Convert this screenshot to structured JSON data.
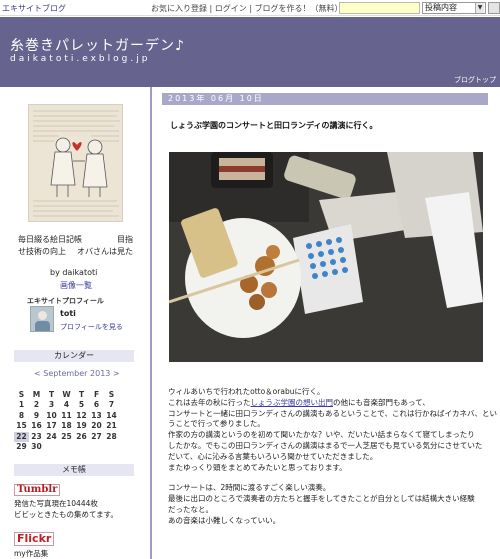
{
  "topbar": {
    "brand": "エキサイトブログ",
    "links": [
      "お気に入り登録",
      "ログイン",
      "ブログを作る！（無料）"
    ],
    "search_value": "",
    "search_scope": "投稿内容"
  },
  "header": {
    "title": "糸巻きパレットガーデン♪",
    "url": "daikatoti.exblog.jp",
    "blog_top": "ブログトップ"
  },
  "sidebar": {
    "diary_line1_left": "毎日綴る絵日記帳",
    "diary_line1_right": "目指",
    "diary_line2_left": "せ技術の向上",
    "diary_line2_right": "オバさんは見た",
    "by": "by daikatoti",
    "gallery_link": "画像一覧",
    "excite_profile": "エキサイトプロフィール",
    "profile_name": "toti",
    "profile_link": "プロフィールを見る",
    "calendar_title": "カレンダー",
    "calendar_month": "< September 2013 >",
    "calendar_rows": [
      [
        "S",
        "M",
        "T",
        "W",
        "T",
        "F",
        "S"
      ],
      [
        "1",
        "2",
        "3",
        "4",
        "5",
        "6",
        "7"
      ],
      [
        "8",
        "9",
        "10",
        "11",
        "12",
        "13",
        "14"
      ],
      [
        "15",
        "16",
        "17",
        "18",
        "19",
        "20",
        "21"
      ],
      [
        "22",
        "23",
        "24",
        "25",
        "26",
        "27",
        "28"
      ],
      [
        "29",
        "30",
        "",
        "",
        "",
        "",
        ""
      ]
    ],
    "memo_title": "メモ帳",
    "tumblr_logo": "Tumblr",
    "tumblr_text1": "発信た写真現在10444枚",
    "tumblr_text2": "ビビッときたもの集めてます。",
    "flickr_logo": "Flickr",
    "flickr_text": "my作品集"
  },
  "post": {
    "date": "2013年 06月 10日",
    "title": "しょうぶ学園のコンサートと田口ランディの講演に行く。",
    "photo_labels": {
      "book": "Less is More",
      "box": "OTTO & ORABU",
      "pamphlet": "SHOBU STYLE",
      "bag": "Le Shogun"
    },
    "body_lines": [
      "ウィルあいちで行われたotto＆orabuに行く。",
      "これは去年の秋に行ったしょうぶ学園の想い出門の他にも音楽部門もあって、",
      "コンサートと一緒に田口ランディさんの講演もあるということで、これは行かねばイカネバ、とい",
      "うことで行って参りました。",
      "作家の方の講演というのを初めて聞いたかな？いや、だいたい話まらなくて寝てしまったり",
      "したかな。でもこの田口ランディさんの講演はまるで一人芝居でも見ている気分にさせていた",
      "だいて、心に沁みる言葉もいろいろ聞かせていただきました。",
      "またゆっくり頭をまとめてみたいと思っております。",
      "",
      "コンサートは、2時間に渡るすごく楽しい演奏。",
      "最後に出口のところで演奏者の方たちと握手をしてきたことが自分としては結構大きい経験",
      "だったなと。",
      "あの音楽は小難しくなっていい。"
    ],
    "link_text": "しょうぶ学園の想い出門"
  }
}
